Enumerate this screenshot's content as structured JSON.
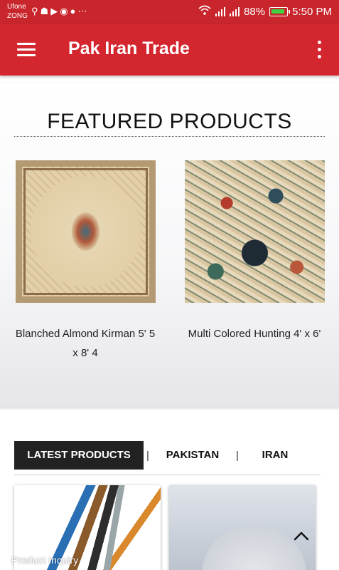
{
  "status_bar": {
    "carrier_1": "Ufone",
    "carrier_2": "ZONG",
    "notification_icons": [
      "usb-icon",
      "snapchat-icon",
      "youtube-icon",
      "media-icon",
      "chat-icon",
      "more-icon"
    ],
    "signal_icons": [
      "wifi-icon",
      "signal-icon",
      "signal-icon"
    ],
    "battery": "88%",
    "time": "5:50 PM"
  },
  "app_bar": {
    "title": "Pak Iran Trade",
    "menu_icon": "hamburger-menu-icon",
    "overflow_icon": "overflow-menu-icon"
  },
  "featured": {
    "title": "FEATURED PRODUCTS",
    "products": [
      {
        "name": "Blanched Almond Kirman 5' 5 x 8' 4",
        "image": "rug-kirman"
      },
      {
        "name": "Multi Colored Hunting 4' x 6'",
        "image": "rug-hunting"
      }
    ]
  },
  "tabs": {
    "items": [
      {
        "label": "LATEST PRODUCTS",
        "active": true
      },
      {
        "label": "PAKISTAN",
        "active": false
      },
      {
        "label": "IRAN",
        "active": false
      }
    ],
    "separator": "|"
  },
  "latest": {
    "cards": [
      {
        "image": "electric-cables"
      },
      {
        "image": "white-powder"
      }
    ]
  },
  "floating": {
    "scroll_top_icon": "chevron-up-icon",
    "inquiry_label": "Product Inquiry"
  },
  "colors": {
    "status_bar": "#c9252c",
    "app_bar": "#d4262e",
    "active_tab": "#222222"
  }
}
